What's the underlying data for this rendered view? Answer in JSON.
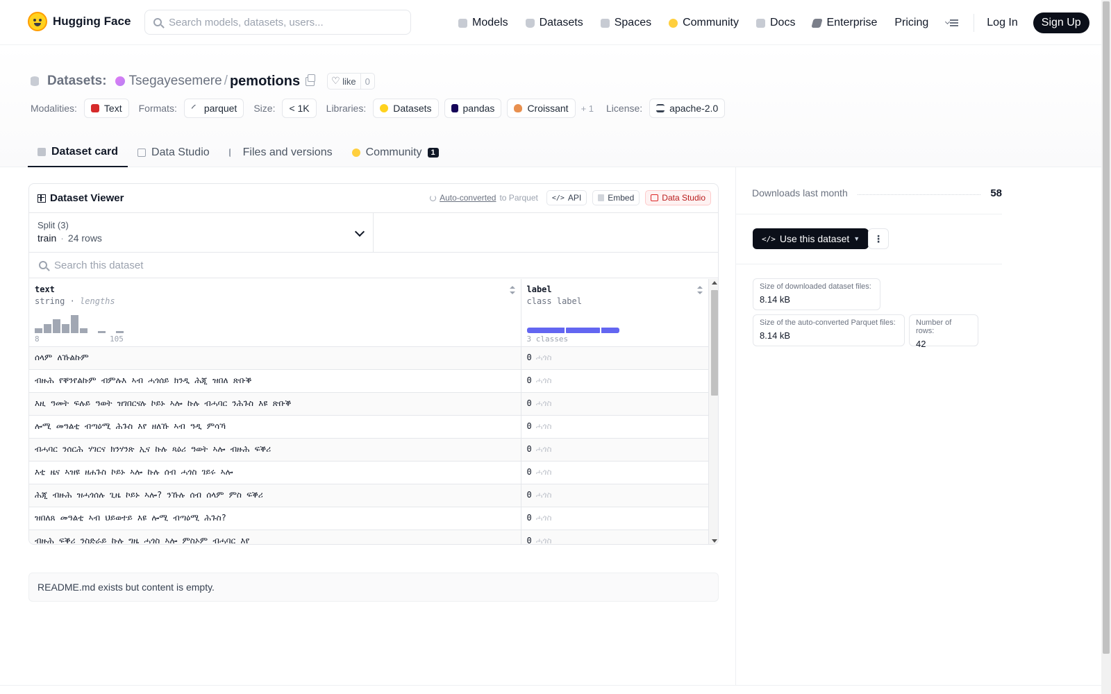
{
  "app": {
    "brand": "Hugging Face"
  },
  "search": {
    "placeholder": "Search models, datasets, users..."
  },
  "nav": {
    "links": [
      "Models",
      "Datasets",
      "Spaces",
      "Community",
      "Docs",
      "Enterprise",
      "Pricing"
    ],
    "login": "Log In",
    "signup": "Sign Up"
  },
  "header": {
    "section": "Datasets:",
    "owner": "Tsegayesemere",
    "slash": "/",
    "repo": "pemotions",
    "like_label": "like",
    "like_count": "0"
  },
  "tags": {
    "modalities_label": "Modalities:",
    "modalities": [
      "Text"
    ],
    "formats_label": "Formats:",
    "formats": [
      "parquet"
    ],
    "size_label": "Size:",
    "size": "< 1K",
    "libraries_label": "Libraries:",
    "libraries": [
      "Datasets",
      "pandas",
      "Croissant"
    ],
    "libraries_more": "+ 1",
    "license_label": "License:",
    "license": "apache-2.0"
  },
  "tabs": [
    {
      "label": "Dataset card"
    },
    {
      "label": "Data Studio"
    },
    {
      "label": "Files and versions"
    },
    {
      "label": "Community",
      "badge": "1"
    }
  ],
  "viewer": {
    "title": "Dataset Viewer",
    "auto_converted": "Auto-converted",
    "to_parquet": "to Parquet",
    "api": "API",
    "embed": "Embed",
    "data_studio": "Data Studio",
    "split_label": "Split (3)",
    "split_value": "train",
    "split_rows": "24 rows",
    "search_placeholder": "Search this dataset",
    "columns": [
      {
        "name": "text",
        "type": "string",
        "stat": "lengths",
        "min": "8",
        "max": "105"
      },
      {
        "name": "label",
        "type": "class label",
        "classes": "3 classes"
      }
    ],
    "length_histogram": [
      1,
      2,
      3,
      2,
      4,
      1,
      0,
      0.5,
      0,
      0.5
    ],
    "class_distribution": [
      0.42,
      0.38,
      0.2
    ],
    "rows": [
      {
        "text": "ሰላም ለኹልኩም",
        "label": "0",
        "label_name": "ሓጎስ"
      },
      {
        "text": "ብዙሕ የቐንየልኩም ብምሉእ ኣብ ሓጎሰይ ክንዲ ሕጂ ዝበለ ጽቡቕ",
        "label": "0",
        "label_name": "ሓጎስ"
      },
      {
        "text": "እዚ ዓመት ፍሉይ ዓወት ዝገበርናሉ ኮይኑ ኣሎ ኩሉ ብሓባር ንሕጉስ እዩ ጽቡቕ",
        "label": "0",
        "label_name": "ሓጎስ"
      },
      {
        "text": "ሎሚ መዓልቲ ብጣዕሚ ሕጉስ እየ ዘለኹ ኣብ ዓዲ ምሳኻ",
        "label": "0",
        "label_name": "ሓጎስ"
      },
      {
        "text": "ብሓባር ንሰርሕ ሃገርና ክንሃንጽ ኢና ኩሉ ጻዕሪ ዓወት ኣሎ ብዙሕ ፍቕሪ",
        "label": "0",
        "label_name": "ሓጎስ"
      },
      {
        "text": "እቲ ዜና ኣዝዩ ዘሐጉስ ኮይኑ ኣሎ ኩሉ ሰብ ሓጎስ ገይሩ ኣሎ",
        "label": "0",
        "label_name": "ሓጎስ"
      },
      {
        "text": "ሕጂ ብዙሕ ዝሓጎሰሉ ጊዜ ኮይኑ ኣሎ? ንኹሉ ሰብ ሰላም ምስ ፍቕሪ",
        "label": "0",
        "label_name": "ሓጎስ"
      },
      {
        "text": "ዝበለጸ መዓልቲ ኣብ ህይወተይ እዩ ሎሚ ብጣዕሚ ሕጉስ?",
        "label": "0",
        "label_name": "ሓጎስ"
      },
      {
        "text": "ብዙሕ ፍቕሪ ንስድራይ ኩሉ ግዜ ሓጎስ ኣሎ ምስኦም ብሓባር እየ",
        "label": "0",
        "label_name": "ሓጎስ"
      }
    ]
  },
  "readme": {
    "text": "README.md exists but content is empty."
  },
  "sidebar": {
    "downloads_label": "Downloads last month",
    "downloads_value": "58",
    "use_dataset": "Use this dataset",
    "stats": [
      {
        "label": "Size of downloaded dataset files:",
        "value": "8.14 kB"
      },
      {
        "label": "Size of the auto-converted Parquet files:",
        "value": "8.14 kB"
      },
      {
        "label": "Number of rows:",
        "value": "42"
      }
    ]
  }
}
